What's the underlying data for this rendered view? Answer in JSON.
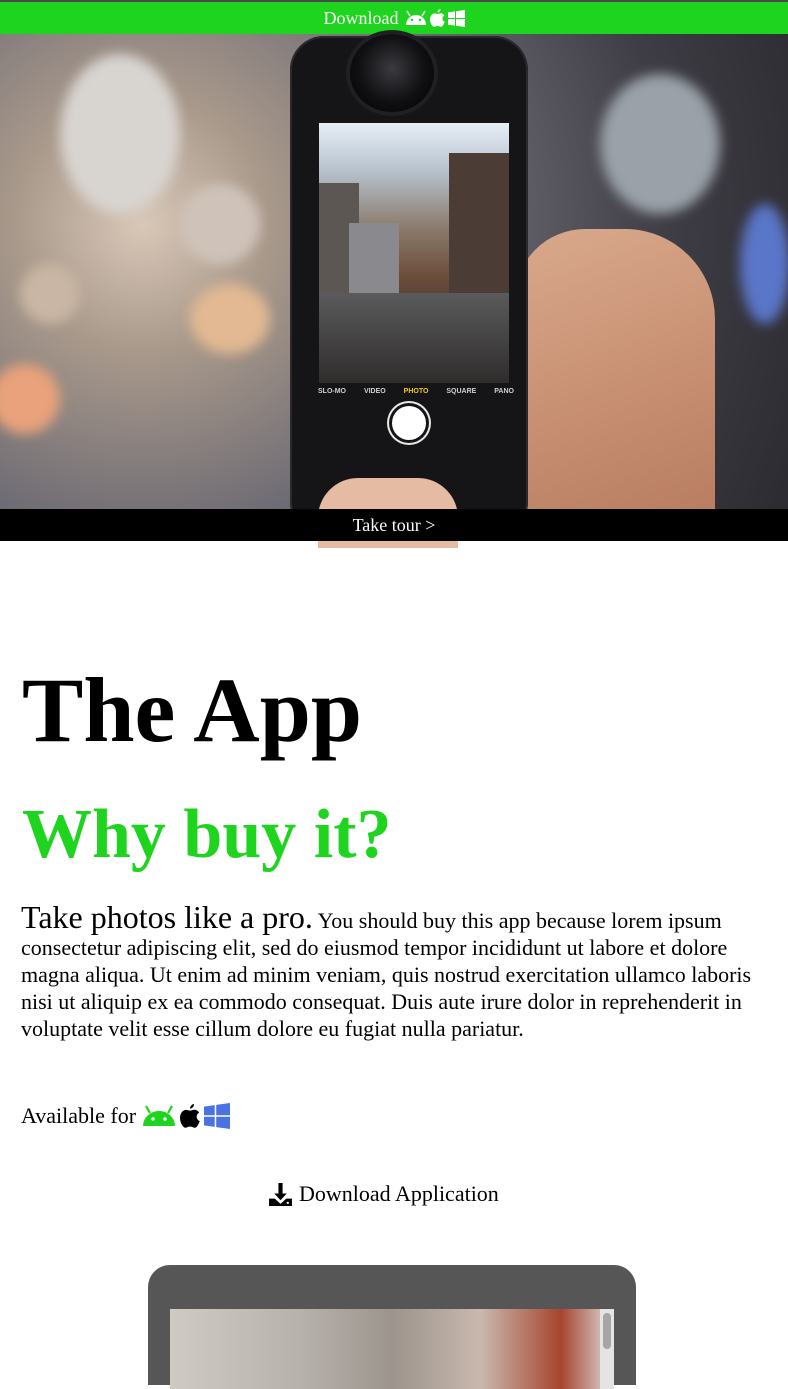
{
  "header": {
    "download_label": "Download",
    "icons": [
      "android-icon",
      "apple-icon",
      "windows-icon"
    ]
  },
  "hero": {
    "camera_modes": [
      "SLO-MO",
      "VIDEO",
      "PHOTO",
      "SQUARE",
      "PANO"
    ],
    "take_tour_label": "Take tour >"
  },
  "main": {
    "title": "The App",
    "subtitle": "Why buy it?",
    "lead": "Take photos like a pro.",
    "body": "You should buy this app because lorem ipsum consectetur adipiscing elit, sed do eiusmod tempor incididunt ut labore et dolore magna aliqua. Ut enim ad minim veniam, quis nostrud exercitation ullamco laboris nisi ut aliquip ex ea commodo consequat. Duis aute irure dolor in reprehenderit in voluptate velit esse cillum dolore eu fugiat nulla pariatur.",
    "available_label": "Available for",
    "download_app_label": "Download Application"
  },
  "colors": {
    "accent": "#1ed41e",
    "android": "#1ed41e",
    "apple": "#000000",
    "windows": "#4a72e0",
    "tour_bar": "#000000"
  }
}
